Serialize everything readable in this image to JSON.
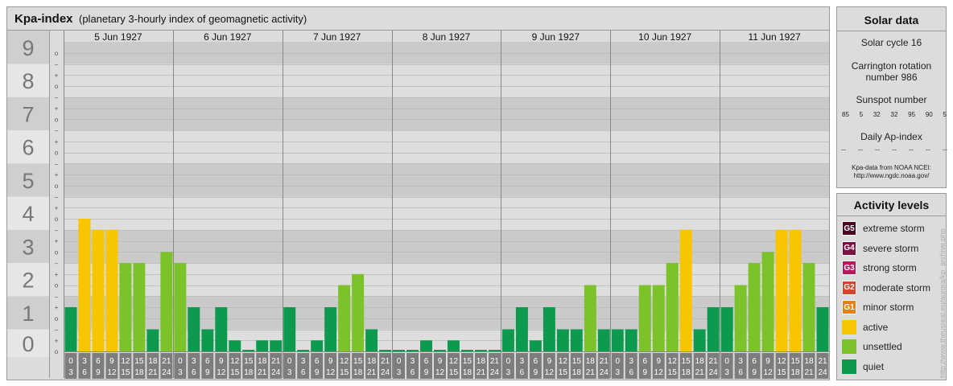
{
  "header": {
    "title": "Kpa-index",
    "subtitle": "(planetary 3-hourly index of geomagnetic activity)"
  },
  "colors": {
    "quiet": "#0d9a4e",
    "unsettled": "#7cc22a",
    "active": "#f7c600",
    "minor_storm": "#e58217",
    "moderate_storm": "#d2462d",
    "strong_storm": "#b5195e",
    "severe_storm": "#7f1045",
    "extreme_storm": "#4b0722",
    "band_dark": "#cacaca",
    "band_light": "#dedede"
  },
  "chart_data": {
    "type": "bar",
    "ylim": [
      0,
      9
    ],
    "y_tick_labels": [
      "0",
      "1",
      "2",
      "3",
      "4",
      "5",
      "6",
      "7",
      "8",
      "9"
    ],
    "sub_tick_labels": [
      "o",
      "+",
      "–",
      "o",
      "+",
      "–",
      "o",
      "+",
      "–",
      "o",
      "+",
      "–",
      "o",
      "+",
      "–",
      "o",
      "+",
      "–",
      "o",
      "+",
      "–",
      "o",
      "+",
      "–",
      "o",
      "+",
      "–",
      "o"
    ],
    "days": [
      "5 Jun 1927",
      "6 Jun 1927",
      "7 Jun 1927",
      "8 Jun 1927",
      "9 Jun 1927",
      "10 Jun 1927",
      "11 Jun 1927"
    ],
    "interval_start_labels": [
      "0",
      "3",
      "6",
      "9",
      "12",
      "15",
      "18",
      "21"
    ],
    "interval_end_labels": [
      "3",
      "6",
      "9",
      "12",
      "15",
      "18",
      "21",
      "24"
    ],
    "series": [
      {
        "values": [
          1.333,
          4.0,
          3.667,
          3.667,
          2.667,
          2.667,
          0.667,
          3.0,
          2.667,
          1.333,
          0.667,
          1.333,
          0.333,
          0.0,
          0.333,
          0.333,
          1.333,
          0.0,
          0.333,
          1.333,
          2.0,
          2.333,
          0.667,
          0.0,
          0.0,
          0.0,
          0.333,
          0.0,
          0.333,
          0.0,
          0.0,
          0.0,
          0.667,
          1.333,
          0.333,
          1.333,
          0.667,
          0.667,
          2.0,
          0.667,
          0.667,
          0.667,
          2.0,
          2.0,
          2.667,
          3.667,
          0.667,
          1.333,
          1.333,
          2.0,
          2.667,
          3.0,
          3.667,
          3.667,
          2.667,
          1.333
        ]
      }
    ]
  },
  "solar": {
    "title": "Solar data",
    "cycle_text": "Solar cycle 16",
    "carrington_line1": "Carrington rotation",
    "carrington_line2": "number 986",
    "sunspot_title": "Sunspot number",
    "sunspot_values": [
      "85",
      "5",
      "32",
      "32",
      "95",
      "90",
      "5"
    ],
    "ap_title": "Daily Ap-index",
    "ap_values": [
      "--",
      "--",
      "--",
      "--",
      "--",
      "--",
      "--"
    ],
    "credit_line1": "Kpa-data from NOAA NCEI:",
    "credit_line2": "http://www.ngdc.noaa.gov/"
  },
  "activity": {
    "title": "Activity levels",
    "items": [
      {
        "badge": "G5",
        "label": "extreme storm",
        "color": "#4b0722"
      },
      {
        "badge": "G4",
        "label": "severe storm",
        "color": "#7f1045"
      },
      {
        "badge": "G3",
        "label": "strong storm",
        "color": "#b5195e"
      },
      {
        "badge": "G2",
        "label": "moderate storm",
        "color": "#d2462d"
      },
      {
        "badge": "G1",
        "label": "minor storm",
        "color": "#e58217"
      },
      {
        "badge": "",
        "label": "active",
        "color": "#f7c600"
      },
      {
        "badge": "",
        "label": "unsettled",
        "color": "#7cc22a"
      },
      {
        "badge": "",
        "label": "quiet",
        "color": "#0d9a4e"
      }
    ]
  },
  "watermark": "http://www.theusreal.eu/aurora/kp_archive.php"
}
